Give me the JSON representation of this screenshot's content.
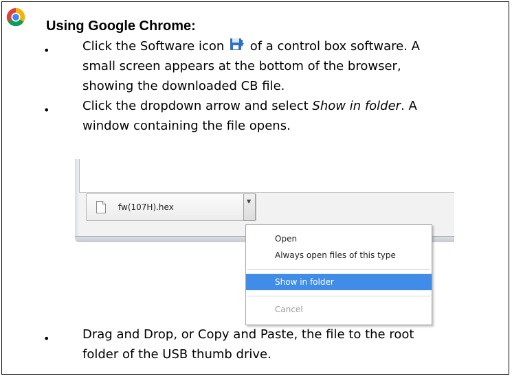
{
  "heading": "Using Google Chrome:",
  "steps": [
    {
      "line1_pre": "Click the Software icon",
      "line1_post": "of a control box software. A",
      "line2": "small screen appears at the bottom of the browser,",
      "line3": "showing the downloaded CB file."
    },
    {
      "line1_pre": "Click the dropdown arrow and select ",
      "line1_italic": "Show in folder",
      "line1_post": ". A",
      "line2": "window containing the file opens."
    },
    {
      "line1": "Drag and Drop, or Copy and Paste, the file to the root",
      "line2": "folder of the USB thumb drive."
    }
  ],
  "bullet_glyph": "•",
  "browser": {
    "download_file_name": "fw(107H).hex",
    "dropdown_arrow_glyph": "▼",
    "context_menu": [
      {
        "label": "Open",
        "state": "normal"
      },
      {
        "label": "Always open files of this type",
        "state": "normal"
      },
      {
        "label": "Show in folder",
        "state": "selected"
      },
      {
        "label": "Cancel",
        "state": "disabled"
      }
    ],
    "selection_color": "#3f8ce9"
  },
  "icons": {
    "logo": "google-chrome-logo",
    "software": "software-download-icon",
    "file": "file-icon"
  }
}
